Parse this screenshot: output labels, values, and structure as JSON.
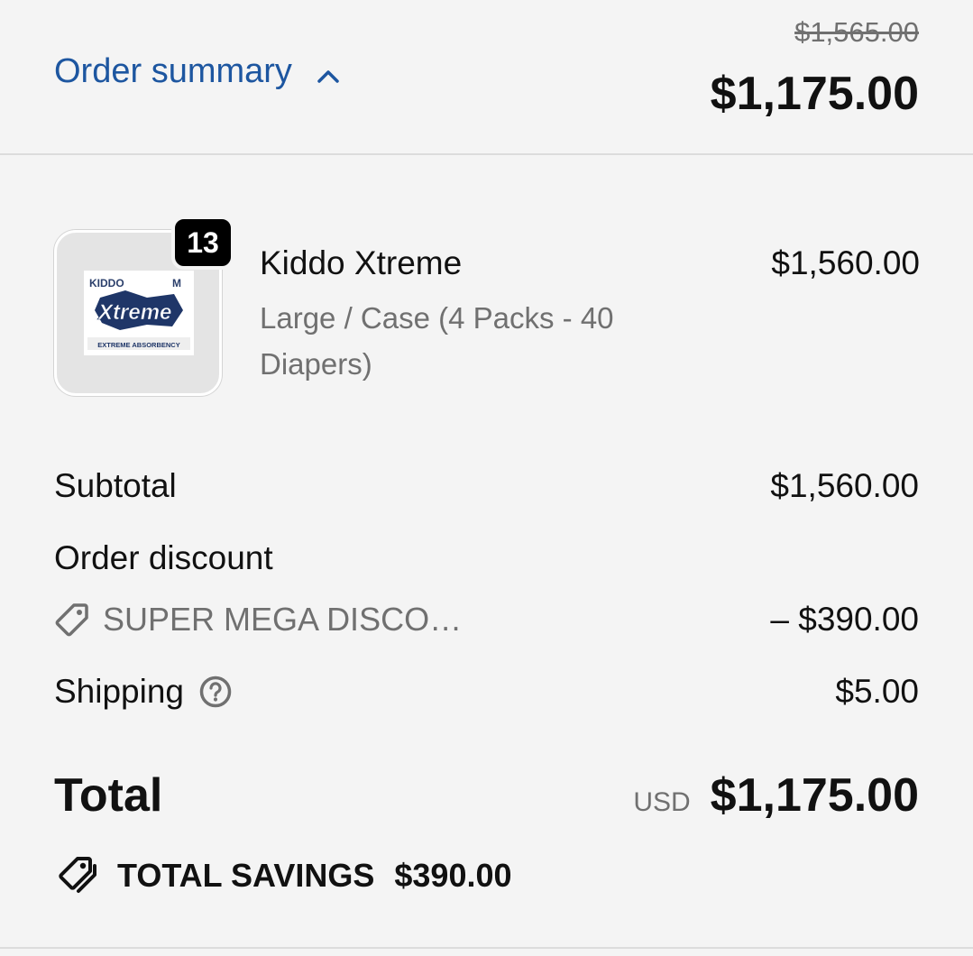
{
  "header": {
    "summary_label": "Order summary",
    "original_price": "$1,565.00",
    "total": "$1,175.00"
  },
  "line_item": {
    "quantity": "13",
    "title": "Kiddo Xtreme",
    "variant": "Large / Case (4 Packs - 40 Diapers)",
    "price": "$1,560.00",
    "image_icon": "product-package-image",
    "image_label": "EXTREME ABSORBENCY"
  },
  "summary": {
    "subtotal_label": "Subtotal",
    "subtotal_value": "$1,560.00",
    "discount_label": "Order discount",
    "discount_code": "SUPER MEGA DISCO…",
    "discount_value": "– $390.00",
    "shipping_label": "Shipping",
    "shipping_value": "$5.00"
  },
  "total": {
    "label": "Total",
    "currency": "USD",
    "amount": "$1,175.00"
  },
  "savings": {
    "label": "TOTAL SAVINGS",
    "amount": "$390.00"
  },
  "colors": {
    "accent": "#1d56a0",
    "background": "#f4f4f4",
    "muted_text": "#707070"
  }
}
